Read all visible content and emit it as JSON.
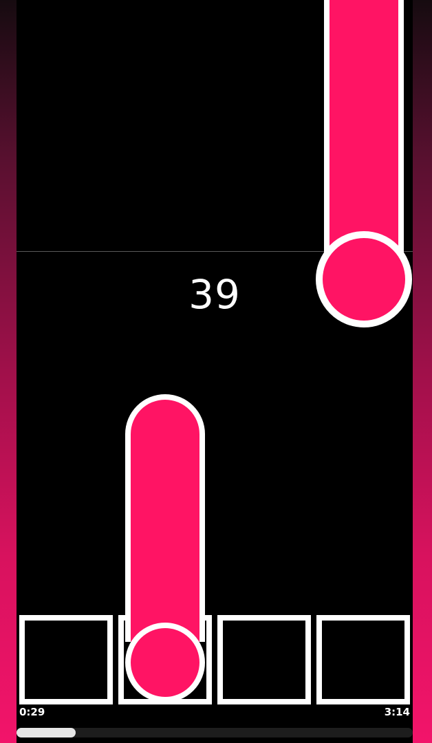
{
  "game": {
    "score": "39",
    "lanes": 4,
    "active_lane": 2
  },
  "player": {
    "elapsed": "0:29",
    "total": "3:14",
    "progress": 0.149
  },
  "colors": {
    "note": "#ff1464",
    "outline": "#ffffff",
    "background": "#000000"
  }
}
